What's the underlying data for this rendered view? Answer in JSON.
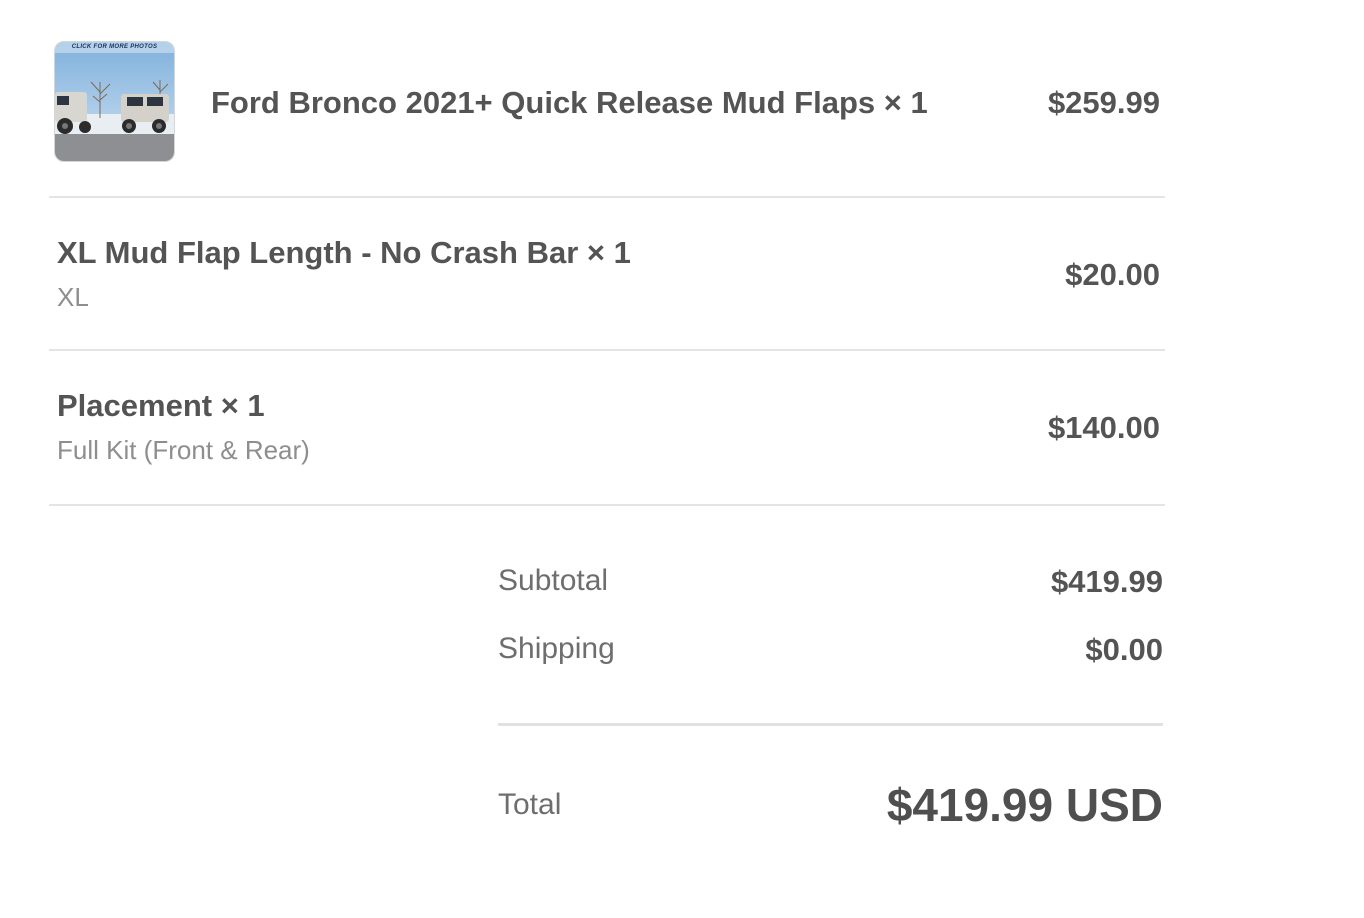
{
  "line_items": [
    {
      "title": "Ford Bronco 2021+ Quick Release Mud Flaps × 1",
      "price": "$259.99",
      "thumbnail_banner": "CLICK FOR MORE PHOTOS",
      "thumbnail_icon": "product-photo"
    },
    {
      "title": "XL Mud Flap Length - No Crash Bar × 1",
      "variant": "XL",
      "price": "$20.00"
    },
    {
      "title": "Placement × 1",
      "variant": "Full Kit (Front & Rear)",
      "price": "$140.00"
    }
  ],
  "summary": {
    "subtotal_label": "Subtotal",
    "subtotal_value": "$419.99",
    "shipping_label": "Shipping",
    "shipping_value": "$0.00",
    "total_label": "Total",
    "total_value": "$419.99 USD"
  },
  "colors": {
    "text_primary": "#545454",
    "text_secondary": "#8e8e8e",
    "divider": "#e4e4e4"
  }
}
